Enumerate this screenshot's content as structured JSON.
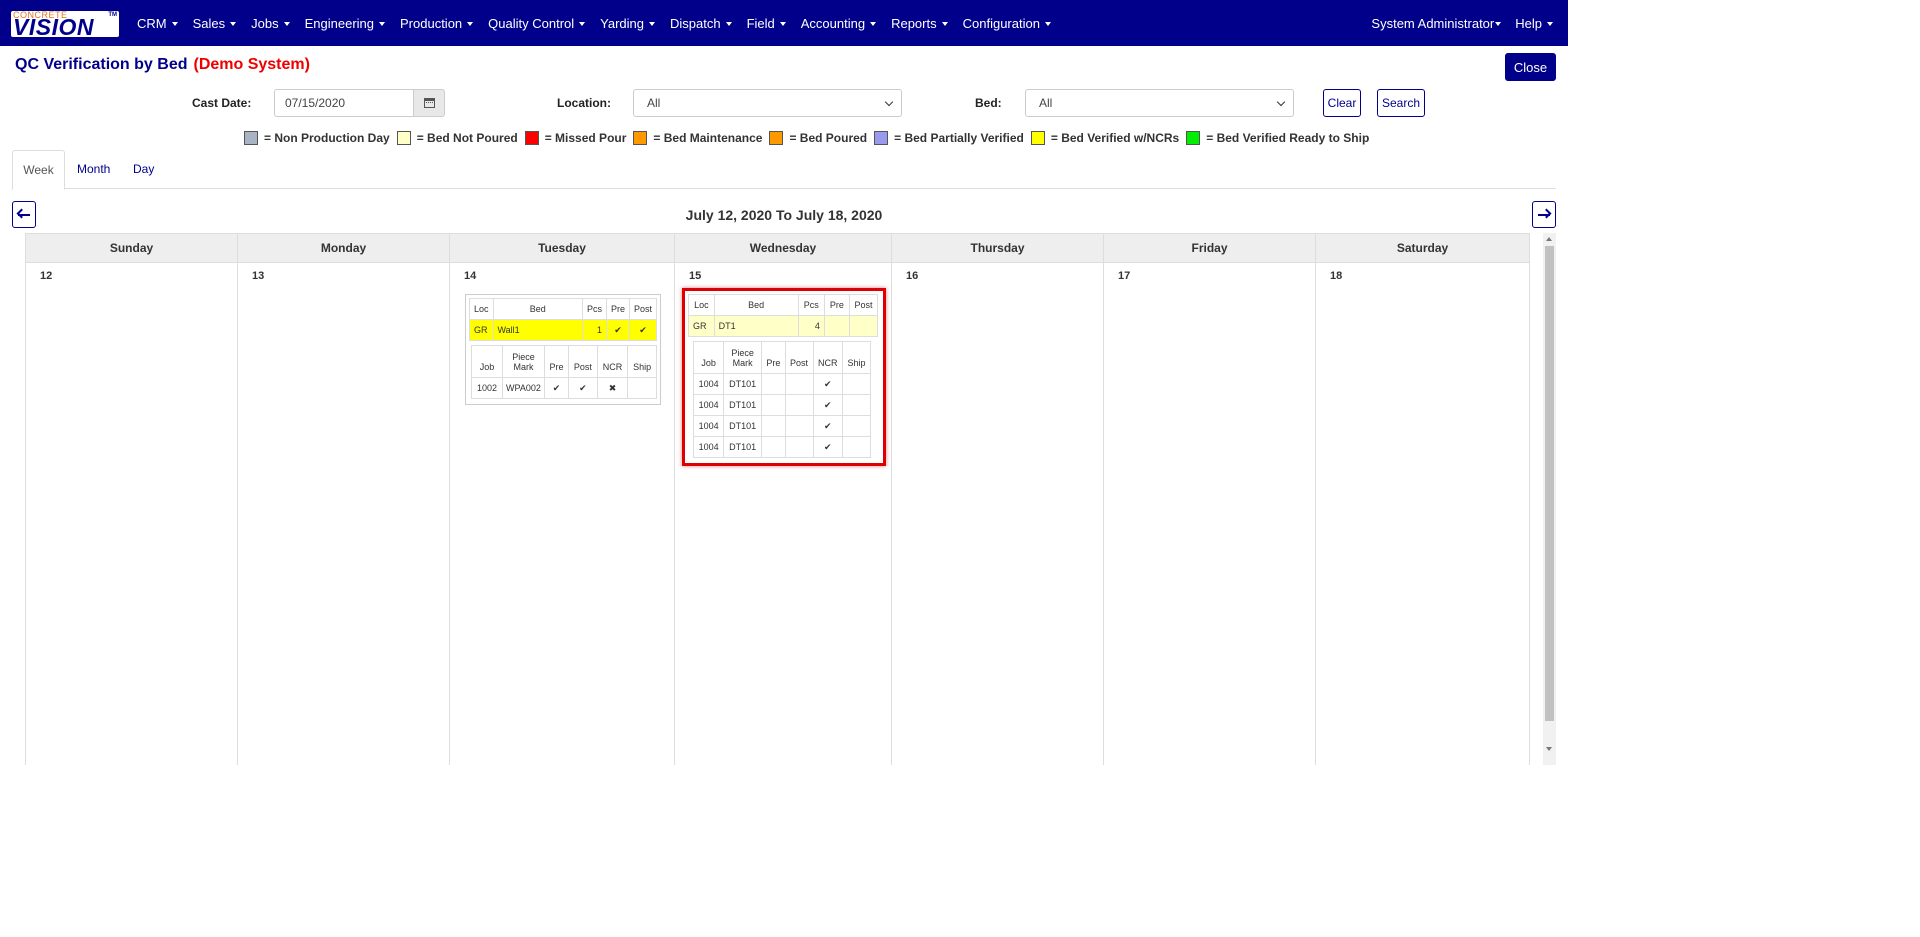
{
  "navbar": {
    "logo_top": "CONCRETE",
    "logo_main": "VISION",
    "logo_tm": "TM",
    "menu": [
      "CRM",
      "Sales",
      "Jobs",
      "Engineering",
      "Production",
      "Quality Control",
      "Yarding",
      "Dispatch",
      "Field",
      "Accounting",
      "Reports",
      "Configuration"
    ],
    "user": "System Administrator",
    "help": "Help"
  },
  "page": {
    "title": "QC Verification by Bed",
    "demo": "(Demo System)",
    "close_label": "Close"
  },
  "filters": {
    "cast_date_label": "Cast Date:",
    "cast_date_value": "07/15/2020",
    "location_label": "Location:",
    "location_value": "All",
    "bed_label": "Bed:",
    "bed_value": "All",
    "clear_label": "Clear",
    "search_label": "Search"
  },
  "legend": [
    {
      "color": "#a8b4c4",
      "label": "= Non Production Day"
    },
    {
      "color": "#ffffc8",
      "label": "= Bed Not Poured"
    },
    {
      "color": "#ff0000",
      "label": "= Missed Pour"
    },
    {
      "color": "#ff9900",
      "label": "= Bed Maintenance"
    },
    {
      "color": "#ff9900",
      "label": "= Bed Poured"
    },
    {
      "color": "#9999ee",
      "label": "= Bed Partially Verified"
    },
    {
      "color": "#ffff00",
      "label": "= Bed Verified w/NCRs"
    },
    {
      "color": "#00ee00",
      "label": "= Bed Verified Ready to Ship"
    }
  ],
  "tabs": [
    "Week",
    "Month",
    "Day"
  ],
  "calendar": {
    "range": "July 12, 2020 To July 18, 2020",
    "days": [
      {
        "name": "Sunday",
        "num": "12"
      },
      {
        "name": "Monday",
        "num": "13"
      },
      {
        "name": "Tuesday",
        "num": "14"
      },
      {
        "name": "Wednesday",
        "num": "15"
      },
      {
        "name": "Thursday",
        "num": "16"
      },
      {
        "name": "Friday",
        "num": "17"
      },
      {
        "name": "Saturday",
        "num": "18"
      }
    ]
  },
  "bed_headers": [
    "Loc",
    "Bed",
    "Pcs",
    "Pre",
    "Post"
  ],
  "piece_headers": [
    "Job",
    "Piece Mark",
    "Pre",
    "Post",
    "NCR",
    "Ship"
  ],
  "tuesday_bed": {
    "loc": "GR",
    "bed": "Wall1",
    "pcs": "1",
    "pre": "✔",
    "post": "✔",
    "pieces": [
      {
        "job": "1002",
        "mark": "WPA002",
        "pre": "✔",
        "post": "✔",
        "ncr": "✖",
        "ship": ""
      }
    ]
  },
  "wednesday_bed": {
    "loc": "GR",
    "bed": "DT1",
    "pcs": "4",
    "pre": "",
    "post": "",
    "pieces": [
      {
        "job": "1004",
        "mark": "DT101",
        "pre": "",
        "post": "",
        "ncr": "✔",
        "ship": ""
      },
      {
        "job": "1004",
        "mark": "DT101",
        "pre": "",
        "post": "",
        "ncr": "✔",
        "ship": ""
      },
      {
        "job": "1004",
        "mark": "DT101",
        "pre": "",
        "post": "",
        "ncr": "✔",
        "ship": ""
      },
      {
        "job": "1004",
        "mark": "DT101",
        "pre": "",
        "post": "",
        "ncr": "✔",
        "ship": ""
      }
    ]
  }
}
